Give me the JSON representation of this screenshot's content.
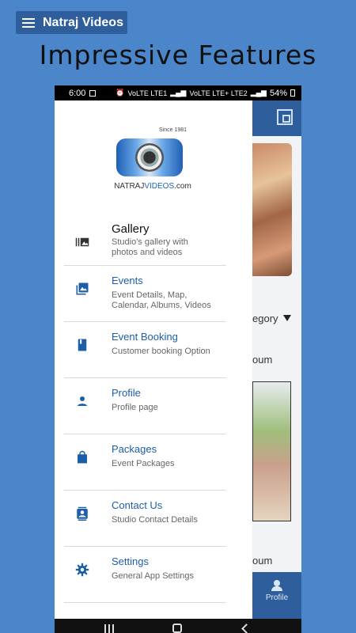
{
  "header": {
    "title": "Natraj Videos"
  },
  "headline": "Impressive Features",
  "status_bar": {
    "time": "6:00",
    "network_1": "VoLTE LTE1",
    "network_2": "VoLTE LTE+ LTE2",
    "battery": "54%"
  },
  "logo": {
    "since": "Since 1981",
    "brand_prefix": "NATRAJ",
    "brand_accent": "VIDEOS",
    "brand_suffix": ".com"
  },
  "background_app": {
    "category_label": "egory",
    "album_label_1": "oum",
    "album_label_2": "oum",
    "bottom_nav_label": "Profile"
  },
  "menu": [
    {
      "label": "Gallery",
      "sub": "Studio's gallery with photos and videos",
      "icon": "gallery-icon"
    },
    {
      "label": "Events",
      "sub": "Event Details, Map, Calendar, Albums, Videos",
      "icon": "image-icon"
    },
    {
      "label": "Event Booking",
      "sub": "Customer booking Option",
      "icon": "book-icon"
    },
    {
      "label": "Profile",
      "sub": "Profile page",
      "icon": "person-icon"
    },
    {
      "label": "Packages",
      "sub": "Event Packages",
      "icon": "shopping-bag-icon"
    },
    {
      "label": "Contact Us",
      "sub": "Studio Contact Details",
      "icon": "contact-card-icon"
    },
    {
      "label": "Settings",
      "sub": "General App Settings",
      "icon": "gear-icon"
    }
  ],
  "colors": {
    "page_bg": "#4a86c9",
    "header_bg": "#2f5e9c",
    "accent": "#1d5ea8"
  }
}
